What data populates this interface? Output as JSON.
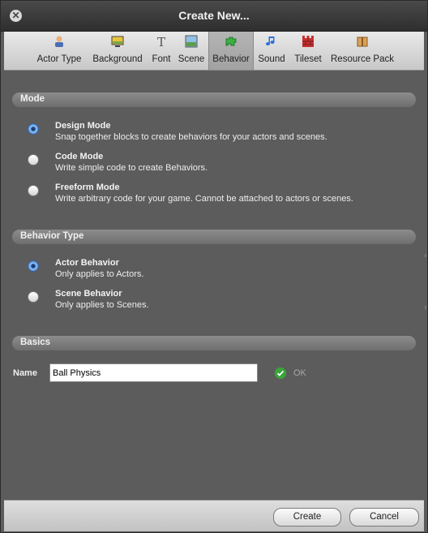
{
  "window": {
    "title": "Create New..."
  },
  "tabs": [
    {
      "label": "Actor Type",
      "icon": "actor-type-icon"
    },
    {
      "label": "Background",
      "icon": "background-icon"
    },
    {
      "label": "Font",
      "icon": "font-icon"
    },
    {
      "label": "Scene",
      "icon": "scene-icon"
    },
    {
      "label": "Behavior",
      "icon": "behavior-icon",
      "selected": true
    },
    {
      "label": "Sound",
      "icon": "sound-icon"
    },
    {
      "label": "Tileset",
      "icon": "tileset-icon"
    },
    {
      "label": "Resource Pack",
      "icon": "resource-pack-icon"
    }
  ],
  "mode": {
    "header": "Mode",
    "options": [
      {
        "title": "Design Mode",
        "desc": "Snap together blocks to create behaviors for your actors and scenes.",
        "selected": true
      },
      {
        "title": "Code Mode",
        "desc": "Write simple code to create Behaviors.",
        "selected": false
      },
      {
        "title": "Freeform Mode",
        "desc": "Write arbitrary code for your game. Cannot be attached to actors or scenes.",
        "selected": false
      }
    ]
  },
  "behavior_type": {
    "header": "Behavior Type",
    "options": [
      {
        "title": "Actor Behavior",
        "desc": "Only applies to Actors.",
        "selected": true
      },
      {
        "title": "Scene Behavior",
        "desc": "Only applies to Scenes.",
        "selected": false
      }
    ]
  },
  "basics": {
    "header": "Basics",
    "name_label": "Name",
    "name_value": "Ball Physics",
    "status": "OK"
  },
  "footer": {
    "create_label": "Create",
    "cancel_label": "Cancel"
  },
  "colors": {
    "dialog_bg": "#5c5c5c",
    "accent_radio": "#4f8ed8",
    "ok_green": "#3aa63a"
  }
}
